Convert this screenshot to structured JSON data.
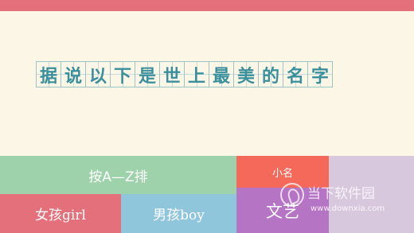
{
  "title_chars": [
    "据",
    "说",
    "以",
    "下",
    "是",
    "世",
    "上",
    "最",
    "美",
    "的",
    "名",
    "字"
  ],
  "tiles": {
    "az": "按A—Z排",
    "nickname": "小名",
    "girl": "女孩girl",
    "boy": "男孩boy",
    "wenyi": "文艺"
  },
  "watermark": {
    "text": "当下软件园",
    "url": "www.downxia.com"
  },
  "colors": {
    "topbar": "#e4707c",
    "background": "#fcf6e6",
    "title_text": "#3a8f9c",
    "az": "#9dd2ab",
    "nickname": "#f4695a",
    "lilac": "#d8c8de",
    "girl": "#e4707c",
    "boy": "#90c6dc",
    "wenyi": "#b574c4"
  }
}
